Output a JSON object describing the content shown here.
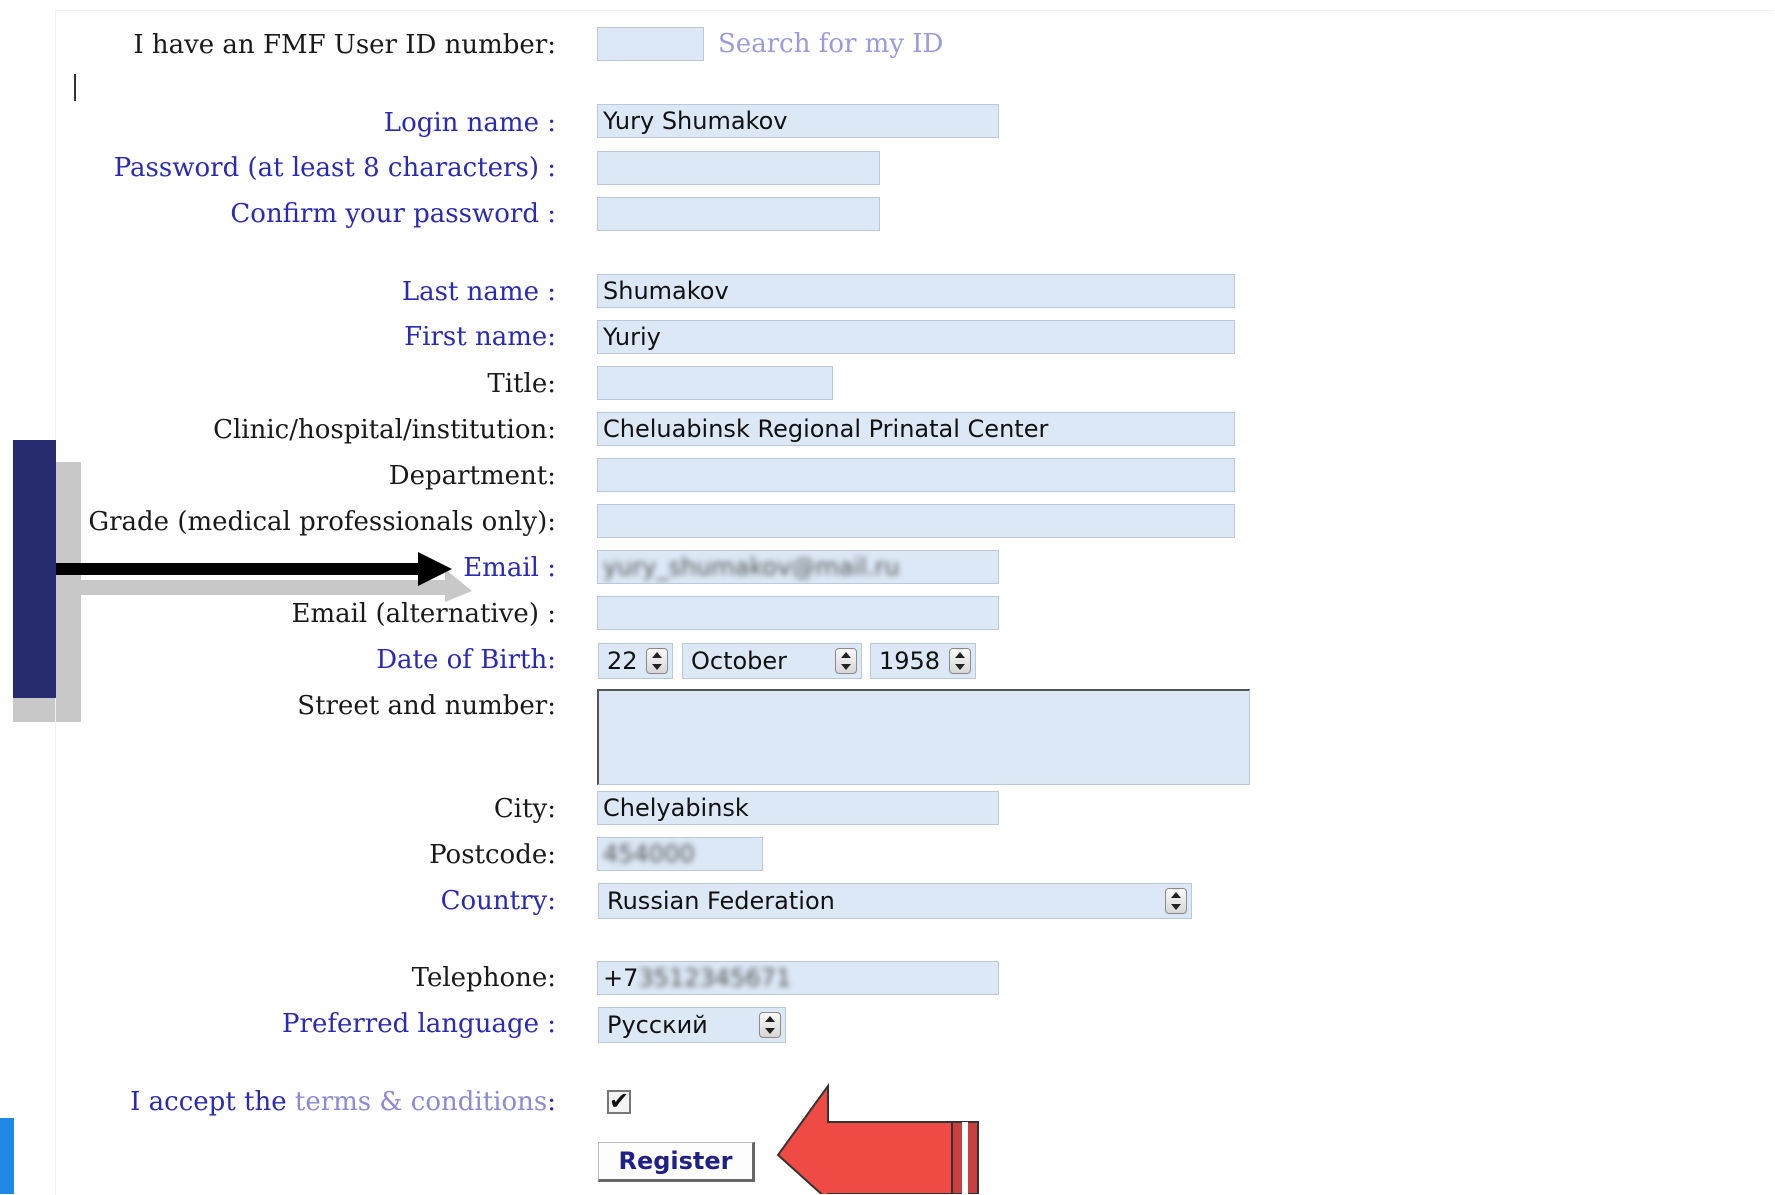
{
  "top": {
    "fmf_id_label": "I have an FMF User ID number:",
    "fmf_id_value": "",
    "search_link": "Search for my ID"
  },
  "account": {
    "login_label": "Login name :",
    "login_value": "Yury Shumakov",
    "password_label": "Password (at least 8 characters) :",
    "password_value": "",
    "confirm_label": "Confirm your password :",
    "confirm_value": ""
  },
  "personal": {
    "last_name_label": "Last name :",
    "last_name_value": "Shumakov",
    "first_name_label": "First name:",
    "first_name_value": "Yuriy",
    "title_label": "Title:",
    "title_value": "",
    "clinic_label": "Clinic/hospital/institution:",
    "clinic_value": "Cheluabinsk Regional Prinatal Center",
    "department_label": "Department:",
    "department_value": "",
    "grade_label": "Grade (medical professionals only):",
    "grade_value": "",
    "email_label": "Email :",
    "email_value": "yury_shumakov@mail.ru",
    "email_alt_label": "Email (alternative) :",
    "email_alt_value": "",
    "dob_label": "Date of Birth:",
    "dob_day": "22",
    "dob_month": "October",
    "dob_year": "1958",
    "street_label": "Street and number:",
    "street_value": "",
    "city_label": "City:",
    "city_value": "Chelyabinsk",
    "postcode_label": "Postcode:",
    "postcode_value": "454000",
    "country_label": "Country:",
    "country_value": "Russian Federation",
    "telephone_label": "Telephone:",
    "telephone_prefix": "+7",
    "telephone_rest": "3512345671",
    "language_label": "Preferred language :",
    "language_value": "Русский"
  },
  "terms": {
    "prefix": "I accept the",
    "link": "terms & conditions",
    "suffix": ":",
    "checked": true,
    "check_glyph": "✔"
  },
  "actions": {
    "register_label": "Register"
  },
  "colors": {
    "required_label": "#2a2ab8",
    "field_bg": "#dce8f6",
    "arrow_red": "#f04a44",
    "arrow_black": "#000000"
  }
}
